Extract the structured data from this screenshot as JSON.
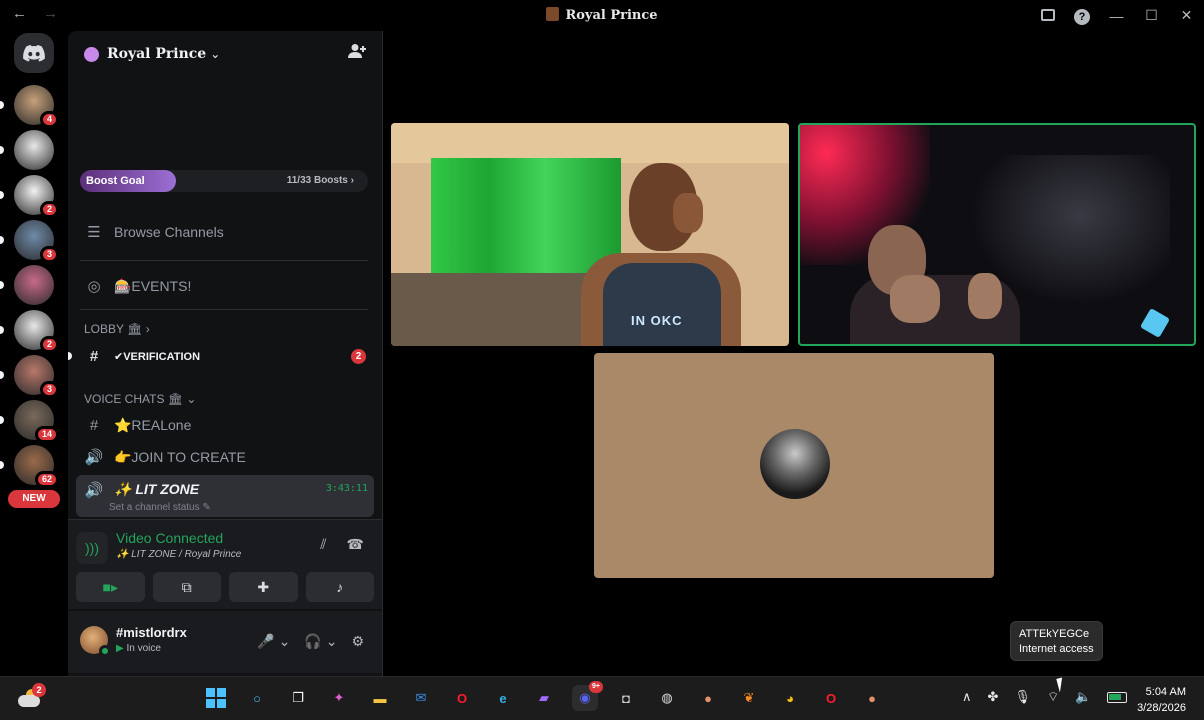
{
  "window": {
    "title": "Royal Prince",
    "back_label": "←",
    "forward_label": "→",
    "help_label": "?",
    "minimize_label": "—",
    "maximize_label": "☐",
    "close_label": "✕"
  },
  "rail": {
    "servers": [
      {
        "badge": "4",
        "color": "#c8a07a"
      },
      {
        "badge": "",
        "color": "#e8e8e8"
      },
      {
        "badge": "2",
        "color": "#f2f2f2"
      },
      {
        "badge": "3",
        "color": "#6e8aa8"
      },
      {
        "badge": "",
        "color": "#c86a8a"
      },
      {
        "badge": "2",
        "color": "#e8e8e8"
      },
      {
        "badge": "3",
        "color": "#b8786a"
      },
      {
        "badge": "14",
        "color": "#7a6a5a"
      },
      {
        "badge": "62",
        "color": "#9a6a4a"
      }
    ],
    "new_label": "NEW"
  },
  "guild": {
    "name": "Royal Prince",
    "chevron": "⌄",
    "boost": {
      "label": "Boost Goal",
      "count": "11/33 Boosts",
      "chevron": "›",
      "progress": 0.333
    },
    "browse_channels": "Browse Channels",
    "events": "🎰EVENTS!",
    "categories": {
      "lobby": "LOBBY 🏛",
      "lobby_chevron": "›",
      "voice": "VOICE CHATS 🏛",
      "voice_chevron": "⌄"
    },
    "channels": {
      "verification": "✔VERIFICATION",
      "verification_mentions": "2",
      "realone": "⭐REALone",
      "join_to_create": "👉JOIN TO CREATE",
      "lit_zone": "✨ LIT ZONE",
      "lit_zone_timer": "3:43:11",
      "lit_zone_status": "Set a channel status"
    }
  },
  "voice": {
    "title": "Video Connected",
    "subtitle": "✨ LIT ZONE / Royal Prince"
  },
  "user": {
    "name": "#mistlordrx",
    "status": "In voice"
  },
  "video_tiles": [
    {
      "user": "streamer-1",
      "speaking": false
    },
    {
      "user": "streamer-2",
      "speaking": true
    },
    {
      "user": "avatar-only",
      "speaking": false
    }
  ],
  "tile_text": {
    "shirt_print": "IN OKC"
  },
  "tooltip": {
    "network": "ATTEkYEGCe",
    "status": "Internet access"
  },
  "taskbar": {
    "weather_badge": "2",
    "discord_badge": "9+",
    "time": "5:04 AM",
    "date": "3/28/2026",
    "tray_chevron": "∧"
  },
  "colors": {
    "accent_green": "#23a55a",
    "mention_red": "#da373c",
    "boost_purple": "#9c6fd4"
  }
}
